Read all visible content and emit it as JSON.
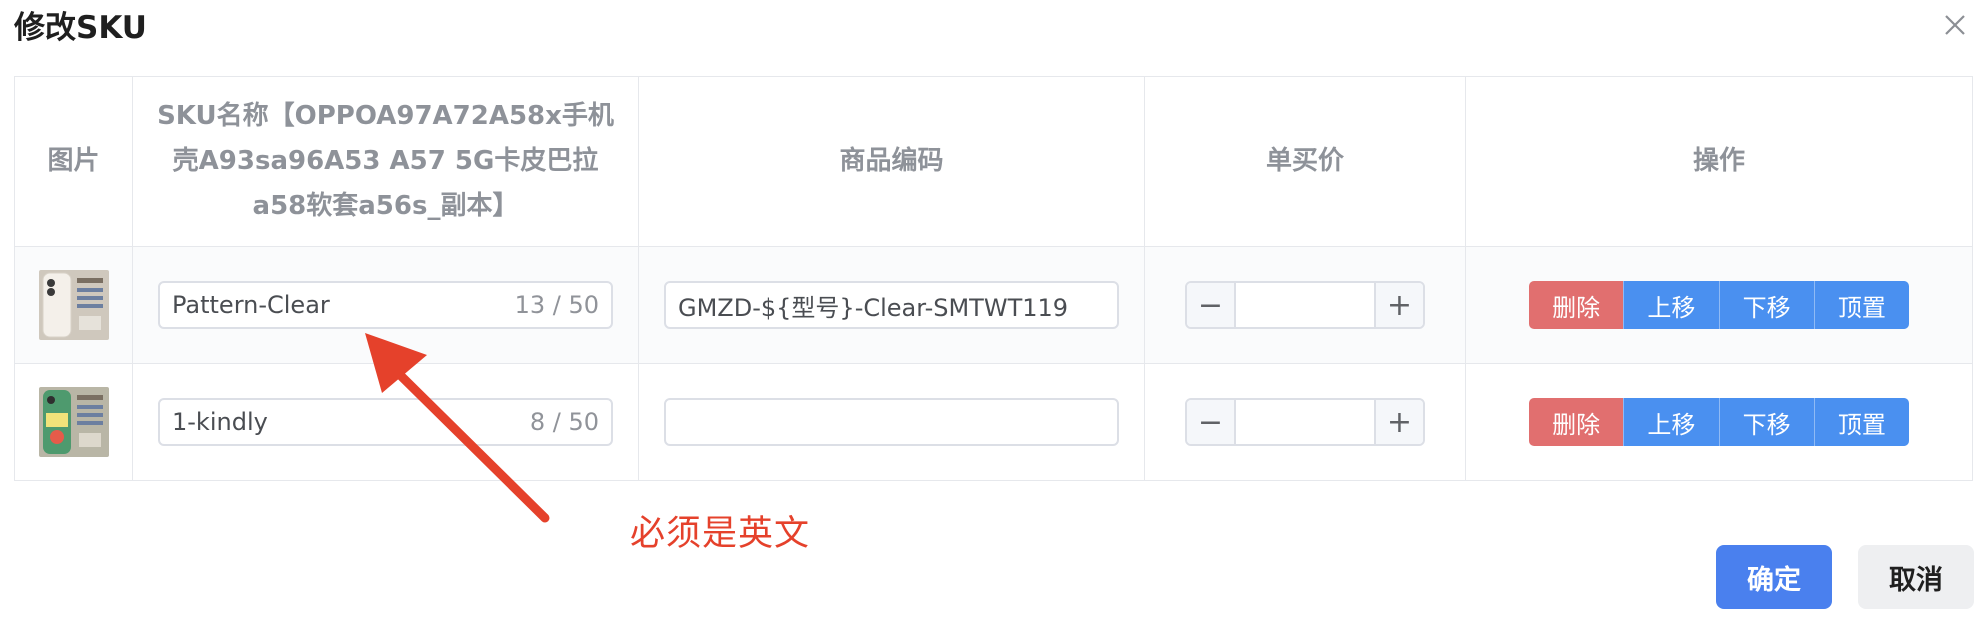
{
  "dialog": {
    "title": "修改SKU",
    "close_icon": "close-icon"
  },
  "table": {
    "headers": {
      "image": "图片",
      "sku_name": "SKU名称【OPPOA97A72A58x手机壳A93sa96A53 A57 5G卡皮巴拉a58软套a56s_副本】",
      "product_code": "商品编码",
      "unit_price": "单买价",
      "actions": "操作"
    },
    "rows": [
      {
        "thumbnail_icon": "phone-case-thumbnail-clear",
        "sku_name": "Pattern-Clear",
        "sku_count": "13 / 50",
        "product_code": "GMZD-${型号}-Clear-SMTWT119",
        "price": ""
      },
      {
        "thumbnail_icon": "phone-case-thumbnail-kindly",
        "sku_name": "1-kindly",
        "sku_count": "8 / 50",
        "product_code": "",
        "price": ""
      }
    ],
    "stepper": {
      "minus": "−",
      "plus": "+"
    },
    "actions": {
      "delete": "删除",
      "move_up": "上移",
      "move_down": "下移",
      "pin_top": "顶置"
    }
  },
  "annotation": {
    "text": "必须是英文",
    "color": "#e5412b"
  },
  "footer": {
    "confirm": "确定",
    "cancel": "取消"
  },
  "colors": {
    "primary": "#4a80ee",
    "action_blue": "#4a90f0",
    "danger": "#e16f6f"
  }
}
